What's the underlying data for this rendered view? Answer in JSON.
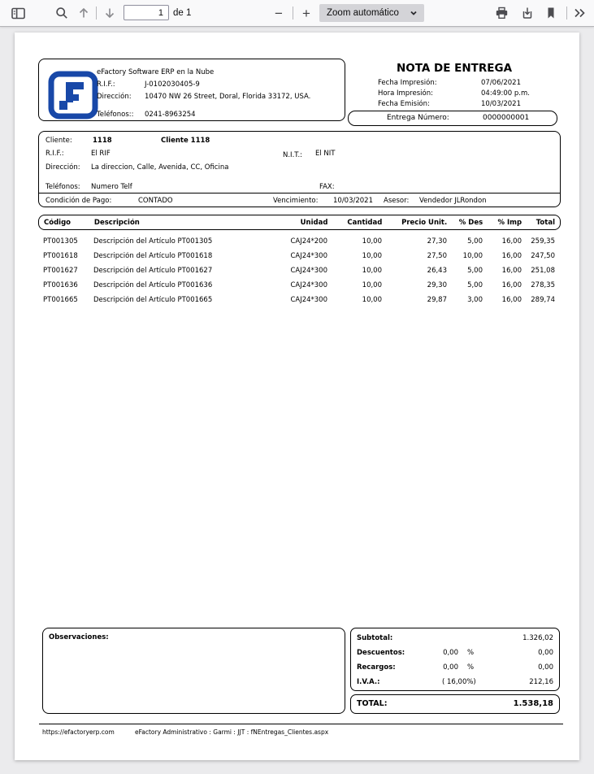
{
  "toolbar": {
    "page_input": "1",
    "page_count": "de 1",
    "zoom_label": "Zoom automático",
    "zoom_out_glyph": "−",
    "zoom_in_glyph": "+"
  },
  "colors": {
    "logo_blue": "#1848a8",
    "toolbar_bg": "#f9f9fa",
    "viewer_bg": "#ebebed"
  },
  "doc": {
    "company": {
      "name": "eFactory Software ERP en la Nube",
      "rif_label": "R.I.F.:",
      "rif": "J-0102030405-9",
      "direccion_label": "Dirección:",
      "direccion": "10470 NW 26 Street, Doral, Florida 33172, USA.",
      "telefonos_label": "Teléfonos::",
      "telefonos": "0241-8963254"
    },
    "header": {
      "title": "NOTA DE ENTREGA",
      "fecha_impresion_label": "Fecha Impresión:",
      "fecha_impresion": "07/06/2021",
      "hora_impresion_label": "Hora Impresión:",
      "hora_impresion": "04:49:00 p.m.",
      "fecha_emision_label": "Fecha Emisión:",
      "fecha_emision": "10/03/2021",
      "entrega_label": "Entrega Número:",
      "entrega_numero": "0000000001"
    },
    "client": {
      "cliente_label": "Cliente:",
      "cliente_codigo": "1118",
      "cliente_nombre": "Cliente 1118",
      "rif_label": "R.I.F.:",
      "rif": "El RIF",
      "nit_label": "N.I.T.:",
      "nit": "El NIT",
      "direccion_label": "Dirección:",
      "direccion": "La direccion, Calle, Avenida, CC, Oficina",
      "telefonos_label": "Teléfonos:",
      "telefonos": "Numero Telf",
      "fax_label": "FAX:",
      "condicion_label": "Condición de Pago:",
      "condicion": "CONTADO",
      "vencimiento_label": "Vencimiento:",
      "vencimiento": "10/03/2021",
      "asesor_label": "Asesor:",
      "asesor": "Vendedor JLRondon"
    },
    "table": {
      "headers": [
        "Código",
        "Descripción",
        "Unidad",
        "Cantidad",
        "Precio Unit.",
        "% Des",
        "% Imp",
        "Total"
      ],
      "rows": [
        [
          "PT001305",
          "Descripción del Artículo PT001305",
          "CAJ24*200",
          "10,00",
          "27,30",
          "5,00",
          "16,00",
          "259,35"
        ],
        [
          "PT001618",
          "Descripción del Artículo PT001618",
          "CAJ24*300",
          "10,00",
          "27,50",
          "10,00",
          "16,00",
          "247,50"
        ],
        [
          "PT001627",
          "Descripción del Artículo PT001627",
          "CAJ24*300",
          "10,00",
          "26,43",
          "5,00",
          "16,00",
          "251,08"
        ],
        [
          "PT001636",
          "Descripción del Artículo PT001636",
          "CAJ24*300",
          "10,00",
          "29,30",
          "5,00",
          "16,00",
          "278,35"
        ],
        [
          "PT001665",
          "Descripción del Artículo PT001665",
          "CAJ24*300",
          "10,00",
          "29,87",
          "3,00",
          "16,00",
          "289,74"
        ]
      ]
    },
    "observaciones_label": "Observaciones:",
    "totals": {
      "subtotal_label": "Subtotal:",
      "subtotal": "1.326,02",
      "descuentos_label": "Descuentos:",
      "descuentos_pct": "0,00",
      "pct_sign": "%",
      "descuentos": "0,00",
      "recargos_label": "Recargos:",
      "recargos_pct": "0,00",
      "recargos": "0,00",
      "iva_label": "I.V.A.:",
      "iva_rate": "( 16,00%)",
      "iva": "212,16",
      "total_label": "TOTAL:",
      "total": "1.538,18"
    },
    "footer": {
      "url": "https://efactoryerp.com",
      "info": "eFactory Administrativo  :  Garmi  :  JJT  :  fNEntregas_Clientes.aspx"
    }
  }
}
